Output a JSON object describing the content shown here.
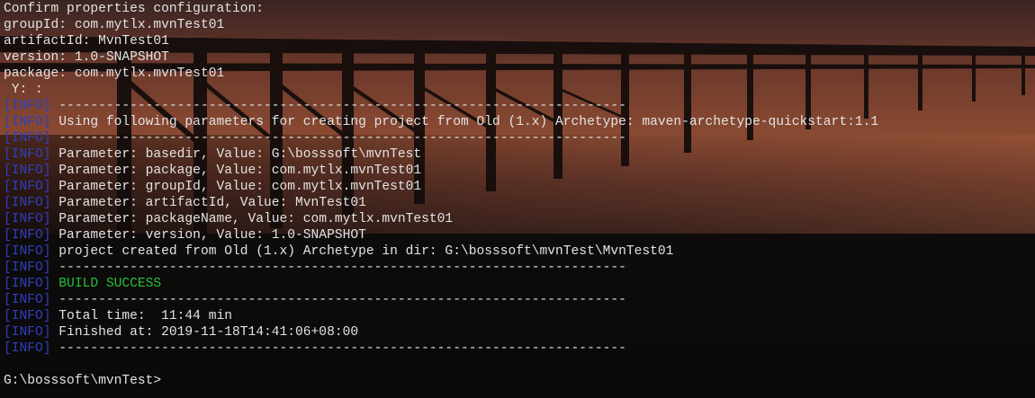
{
  "terminal": {
    "lines": [
      {
        "prefix": "",
        "text": "Confirm properties configuration:",
        "kind": "plain"
      },
      {
        "prefix": "",
        "text": "groupId: com.mytlx.mvnTest01",
        "kind": "plain"
      },
      {
        "prefix": "",
        "text": "artifactId: MvnTest01",
        "kind": "plain"
      },
      {
        "prefix": "",
        "text": "version: 1.0-SNAPSHOT",
        "kind": "plain"
      },
      {
        "prefix": "",
        "text": "package: com.mytlx.mvnTest01",
        "kind": "plain"
      },
      {
        "prefix": "",
        "text": " Y: :",
        "kind": "plain"
      },
      {
        "prefix": "[INFO]",
        "text": " ------------------------------------------------------------------------",
        "kind": "info"
      },
      {
        "prefix": "[INFO]",
        "text": " Using following parameters for creating project from Old (1.x) Archetype: maven-archetype-quickstart:1.1",
        "kind": "info"
      },
      {
        "prefix": "[INFO]",
        "text": " ------------------------------------------------------------------------",
        "kind": "info"
      },
      {
        "prefix": "[INFO]",
        "text": " Parameter: basedir, Value: G:\\bosssoft\\mvnTest",
        "kind": "info"
      },
      {
        "prefix": "[INFO]",
        "text": " Parameter: package, Value: com.mytlx.mvnTest01",
        "kind": "info"
      },
      {
        "prefix": "[INFO]",
        "text": " Parameter: groupId, Value: com.mytlx.mvnTest01",
        "kind": "info"
      },
      {
        "prefix": "[INFO]",
        "text": " Parameter: artifactId, Value: MvnTest01",
        "kind": "info"
      },
      {
        "prefix": "[INFO]",
        "text": " Parameter: packageName, Value: com.mytlx.mvnTest01",
        "kind": "info"
      },
      {
        "prefix": "[INFO]",
        "text": " Parameter: version, Value: 1.0-SNAPSHOT",
        "kind": "info"
      },
      {
        "prefix": "[INFO]",
        "text": " project created from Old (1.x) Archetype in dir: G:\\bosssoft\\mvnTest\\MvnTest01",
        "kind": "info"
      },
      {
        "prefix": "[INFO]",
        "text": " ------------------------------------------------------------------------",
        "kind": "info"
      },
      {
        "prefix": "[INFO]",
        "text": " BUILD SUCCESS",
        "kind": "success"
      },
      {
        "prefix": "[INFO]",
        "text": " ------------------------------------------------------------------------",
        "kind": "info"
      },
      {
        "prefix": "[INFO]",
        "text": " Total time:  11:44 min",
        "kind": "info"
      },
      {
        "prefix": "[INFO]",
        "text": " Finished at: 2019-11-18T14:41:06+08:00",
        "kind": "info"
      },
      {
        "prefix": "[INFO]",
        "text": " ------------------------------------------------------------------------",
        "kind": "info"
      },
      {
        "prefix": "",
        "text": "",
        "kind": "blank"
      },
      {
        "prefix": "",
        "text": "G:\\bosssoft\\mvnTest>",
        "kind": "prompt"
      }
    ]
  },
  "colors": {
    "text": "#e3e3e3",
    "info_tag": "#2f3fbf",
    "success": "#27c03a",
    "background": "#0b0a0a"
  }
}
